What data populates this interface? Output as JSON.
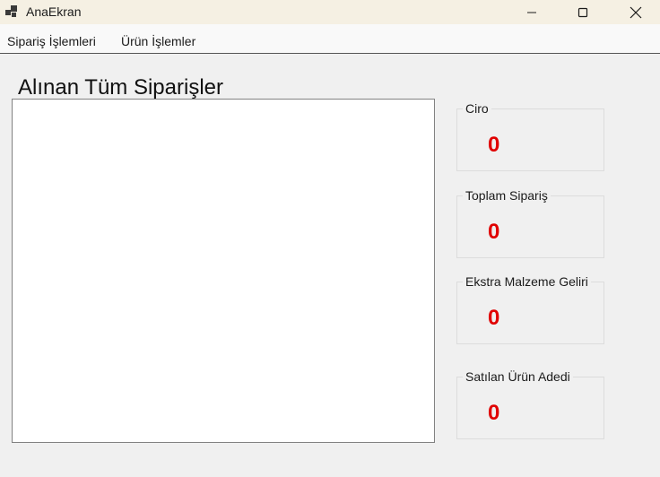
{
  "window": {
    "title": "AnaEkran",
    "controls": [
      "minimize",
      "maximize",
      "close"
    ]
  },
  "menu": {
    "items": [
      {
        "label": "Sipariş İşlemleri"
      },
      {
        "label": "Ürün İşlemler"
      }
    ]
  },
  "main": {
    "heading": "Alınan Tüm Siparişler",
    "orders": []
  },
  "stats": [
    {
      "label": "Ciro",
      "value": "0"
    },
    {
      "label": "Toplam Sipariş",
      "value": "0"
    },
    {
      "label": "Ekstra Malzeme Geliri",
      "value": "0"
    },
    {
      "label": "Satılan Ürün Adedi",
      "value": "0"
    }
  ],
  "colors": {
    "value": "#e00000",
    "titlebar": "#f5f0e3",
    "background": "#f0f0f0"
  }
}
